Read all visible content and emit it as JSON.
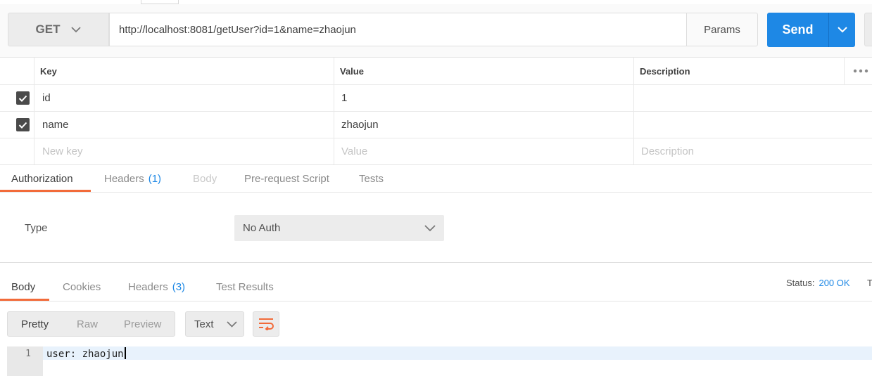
{
  "request": {
    "method": "GET",
    "url": "http://localhost:8081/getUser?id=1&name=zhaojun",
    "params_label": "Params",
    "send_label": "Send"
  },
  "params_table": {
    "headers": {
      "key": "Key",
      "value": "Value",
      "description": "Description"
    },
    "rows": [
      {
        "checked": true,
        "key": "id",
        "value": "1",
        "description": ""
      },
      {
        "checked": true,
        "key": "name",
        "value": "zhaojun",
        "description": ""
      }
    ],
    "new_row": {
      "key_placeholder": "New key",
      "value_placeholder": "Value",
      "description_placeholder": "Description"
    }
  },
  "request_tabs": {
    "authorization": "Authorization",
    "headers": "Headers",
    "headers_count": "(1)",
    "body": "Body",
    "prerequest": "Pre-request Script",
    "tests": "Tests",
    "active": "Authorization"
  },
  "auth": {
    "type_label": "Type",
    "type_value": "No Auth"
  },
  "response_tabs": {
    "body": "Body",
    "cookies": "Cookies",
    "headers": "Headers",
    "headers_count": "(3)",
    "test_results": "Test Results",
    "active": "Body"
  },
  "status": {
    "label": "Status:",
    "value": "200 OK",
    "next_fragment": "T"
  },
  "response_view": {
    "modes": [
      "Pretty",
      "Raw",
      "Preview"
    ],
    "active_mode": "Pretty",
    "format": "Text"
  },
  "editor": {
    "line_number": "1",
    "line_text": "user: zhaojun"
  },
  "colors": {
    "accent": "#1e88e5",
    "tab_underline": "#f26b3a",
    "wrap_icon": "#f26b3a"
  }
}
